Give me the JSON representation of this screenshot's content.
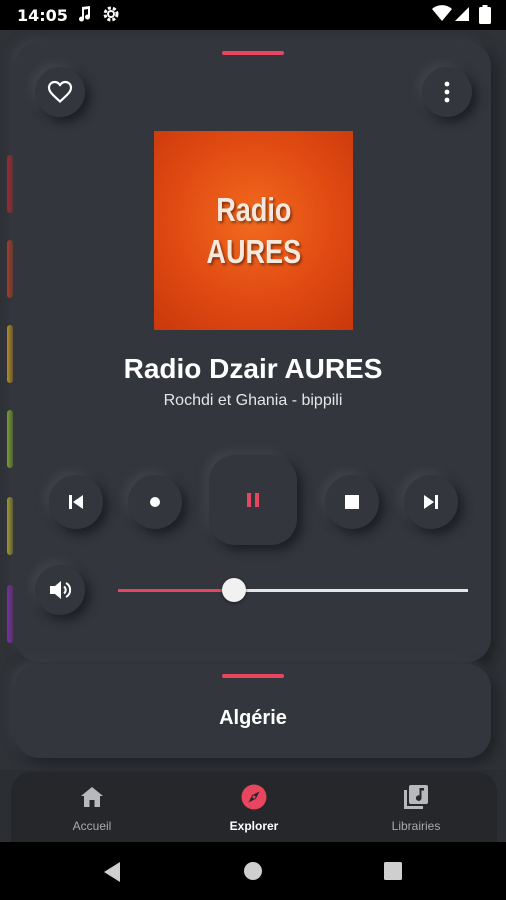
{
  "status_bar": {
    "time": "14:05",
    "icons": [
      "music-note-icon",
      "settings-icon",
      "wifi-icon",
      "signal-icon",
      "battery-icon"
    ]
  },
  "player": {
    "favorite_icon": "heart-outline-icon",
    "menu_icon": "more-vertical-icon",
    "artwork": {
      "line1": "Radio",
      "line2": "AURES"
    },
    "station_name": "Radio Dzair AURES",
    "now_playing": "Rochdi et Ghania - bippili",
    "controls": [
      "skip-previous-icon",
      "record-icon",
      "pause-icon",
      "stop-icon",
      "skip-next-icon"
    ],
    "volume_icon": "volume-icon",
    "volume_level": 0.35
  },
  "country_panel": {
    "label": "Algérie"
  },
  "bottom_nav": [
    {
      "label": "Accueil",
      "icon": "home-icon",
      "active": false
    },
    {
      "label": "Explorer",
      "icon": "compass-icon",
      "active": true
    },
    {
      "label": "Librairies",
      "icon": "library-icon",
      "active": false
    }
  ],
  "colors": {
    "accent": "#e8455f",
    "background": "#2b2e33",
    "card": "#33363c",
    "nav": "#25272b"
  }
}
